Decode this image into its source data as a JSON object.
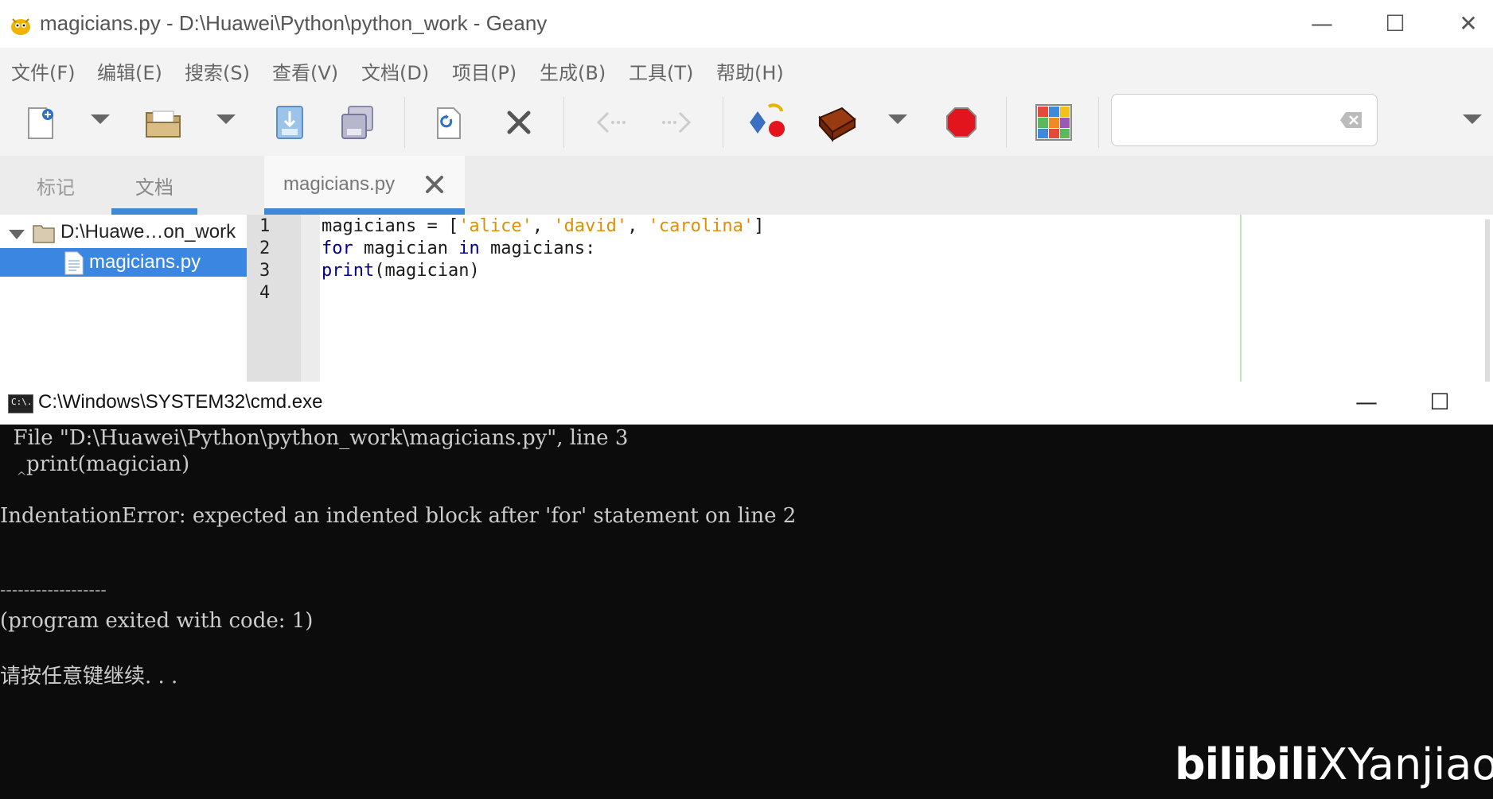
{
  "geany": {
    "window_title": "magicians.py - D:\\Huawei\\Python\\python_work - Geany",
    "win_controls": {
      "minimize": "—",
      "maximize": "☐",
      "close": "✕"
    },
    "menu": [
      "文件(F)",
      "编辑(E)",
      "搜索(S)",
      "查看(V)",
      "文档(D)",
      "项目(P)",
      "生成(B)",
      "工具(T)",
      "帮助(H)"
    ],
    "toolbar_icons": [
      "new-file-icon",
      "open-file-icon",
      "save-icon",
      "save-all-icon",
      "reload-icon",
      "close-icon",
      "back-icon",
      "forward-icon",
      "compile-icon",
      "build-icon",
      "stop-icon",
      "color-chooser-icon",
      "clear-icon"
    ],
    "sidebar": {
      "tabs": [
        "标记",
        "文档"
      ],
      "folder": "D:\\Huawe…on_work",
      "file": "magicians.py"
    },
    "editor": {
      "tab_label": "magicians.py",
      "line_numbers": [
        "1",
        "2",
        "3",
        "4"
      ],
      "lines": [
        {
          "t1": "magicians = [",
          "s1": "'alice'",
          "t2": ", ",
          "s2": "'david'",
          "t3": ", ",
          "s3": "'carolina'",
          "t4": "]"
        },
        {
          "k1": "for",
          "t1": " magician ",
          "k2": "in",
          "t2": " magicians:"
        },
        {
          "k1": "print",
          "t1": "(magician)"
        }
      ]
    }
  },
  "cmd": {
    "title": "C:\\Windows\\SYSTEM32\\cmd.exe",
    "icon_text": "C:\\.",
    "win_controls": {
      "minimize": "—",
      "maximize": "☐"
    },
    "lines": [
      "  File \"D:\\Huawei\\Python\\python_work\\magicians.py\", line 3",
      "    print(magician)",
      "    ^",
      "IndentationError: expected an indented block after 'for' statement on line 2",
      "------------------",
      "(program exited with code: 1)",
      "请按任意键继续. . ."
    ]
  },
  "watermark": {
    "brand": "bilibili",
    "name": "XYanjiao"
  },
  "colors": {
    "keyword": "#00008b",
    "string": "#e08f00",
    "accent": "#3f87d8",
    "selection": "#3b86e0"
  }
}
